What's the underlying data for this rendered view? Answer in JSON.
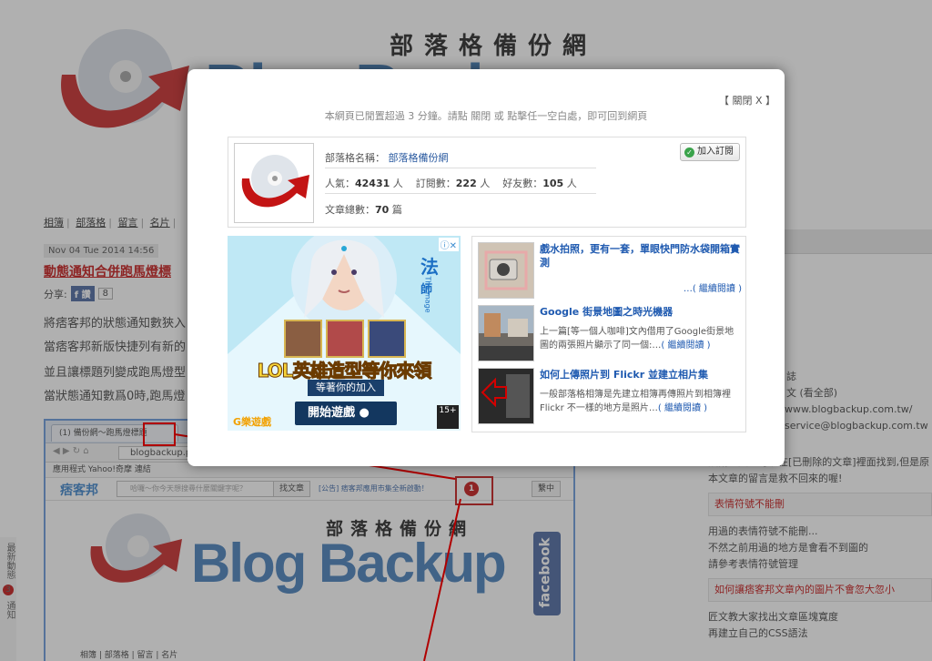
{
  "background": {
    "site_name": "部落格備份網",
    "brand_partial": "Blog Backup",
    "nav": [
      "相簿",
      "部落格",
      "留言",
      "名片"
    ],
    "post": {
      "date": "Nov 04 Tue 2014 14:56",
      "title": "動態通知合併跑馬燈標",
      "share_label": "分享:",
      "fb_label": "讚",
      "share_count": "8",
      "paragraphs": [
        "將痞客邦的狀態通知數狹入",
        "當痞客邦新版快捷列有新的",
        "並且讓標題列變成跑馬燈型",
        "當狀態通知數爲0時,跑馬燈"
      ]
    },
    "screenshot": {
      "tab_title": "(1) 備份網～跑馬燈標題",
      "url": "blogbackup.pixnet.net",
      "bookmarks": "應用程式  Yahoo!奇摩  連結",
      "pixnet_logo": "痞客邦",
      "search_placeholder": "哈囉～你今天想搜尋什麼關鍵字呢？",
      "btn_articles": "找文章",
      "notice": "[公告] 痞客邦應用市集全新啟動！",
      "alert_count": "1",
      "btn_side": "繫中",
      "site_name": "部落格備份網",
      "brand": "Blog Backup",
      "facebook": "facebook",
      "bottom_nav": "相簿 | 部落格 | 留言 | 名片"
    },
    "left_strip": [
      "最新動態",
      "3",
      "通知"
    ],
    "sidebar": {
      "rows": [
        "誌",
        "文 (看全部)",
        "www.blogbackup.com.tw/",
        "service@blogbackup.com.tw"
      ],
      "text1": "誤刪的文章可以在[已刪除的文章]裡面找到,但是原",
      "text2": "本文章的留言是救不回來的喔!",
      "head1": "表情符號不能刪",
      "text3": "用過的表情符號不能刪...",
      "text4": "不然之前用過的地方是會看不到圖的",
      "text5": "請參考表情符號管理",
      "head2": "如何讓痞客邦文章內的圖片不會忽大忽小",
      "text6": "匠文教大家找出文章區塊寬度",
      "text7": "再建立自己的CSS語法"
    }
  },
  "modal": {
    "close_label": "【 關閉 X 】",
    "notice": "本網頁已閒置超過 3 分鐘。請點 關閉 或 點擊任一空白處，即可回到網頁",
    "blog_name_label": "部落格名稱：",
    "blog_name": "部落格備份網",
    "popularity_label": "人氣：",
    "popularity": "42431",
    "people": "人",
    "subscribers_label": "訂閱數：",
    "subscribers": "222",
    "friends_label": "好友數：",
    "friends": "105",
    "articles_label": "文章總數：",
    "articles": "70",
    "articles_unit": "篇",
    "subscribe_button": "加入訂閱",
    "ad": {
      "class_name": "法",
      "class_name2": "師",
      "class_en": "The mage",
      "title": "LOL英雄造型等你來領",
      "sub": "等著你的加入",
      "button": "開始遊戲",
      "game_logo": "G樂遊戲",
      "rating": "15+"
    },
    "related": [
      {
        "title": "戲水拍照，更有一套，單眼快門防水袋開箱實測",
        "desc": "",
        "more": "…( 繼續閱讀 )"
      },
      {
        "title": "Google 街景地圖之時光機器",
        "desc": "上一篇[等一個人咖啡]文內借用了Google街景地圖的兩張照片顯示了同一個:…",
        "more": "( 繼續閱讀 )"
      },
      {
        "title": "如何上傳照片到 Flickr 並建立相片集",
        "desc": "一般部落格相簿是先建立相簿再傳照片到相簿裡Flickr 不一樣的地方是照片…",
        "more": "( 繼續閱讀 )"
      }
    ]
  },
  "colors": {
    "accent_red": "#c00000",
    "link_blue": "#1f5ab0",
    "brand_blue": "#2f6fb1"
  }
}
